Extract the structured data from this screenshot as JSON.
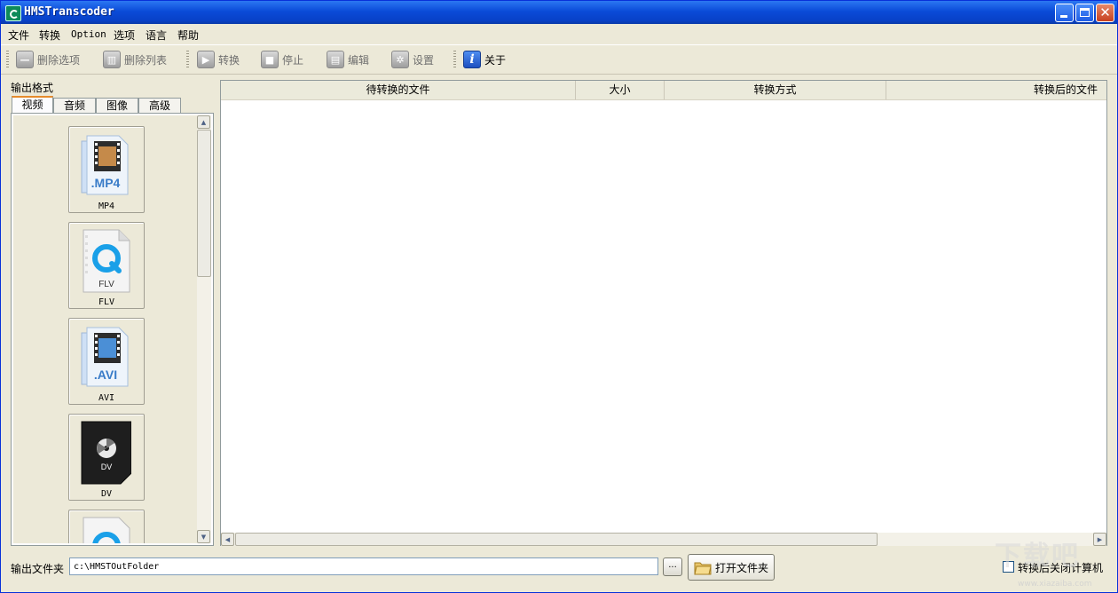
{
  "window": {
    "title": "HMSTranscoder"
  },
  "menu": [
    "文件",
    "转换",
    "Option",
    "选项",
    "语言",
    "帮助"
  ],
  "toolbar": {
    "delete_item": "删除选项",
    "delete_list": "删除列表",
    "convert": "转换",
    "stop": "停止",
    "edit": "编辑",
    "settings": "设置",
    "about": "关于"
  },
  "left": {
    "output_format_label": "输出格式",
    "tabs": [
      "视频",
      "音频",
      "图像",
      "高级"
    ],
    "formats": [
      {
        "name": "MP4",
        "badge": ".MP4"
      },
      {
        "name": "FLV",
        "badge": "FLV"
      },
      {
        "name": "AVI",
        "badge": ".AVI"
      },
      {
        "name": "DV",
        "badge": "DV"
      },
      {
        "name": "",
        "badge": ""
      }
    ]
  },
  "table": {
    "columns": [
      "待转换的文件",
      "大小",
      "转换方式",
      "转换后的文件"
    ]
  },
  "bottom": {
    "output_folder_label": "输出文件夹",
    "output_folder_value": "c:\\HMSTOutFolder",
    "browse_label": "...",
    "open_folder_label": "打开文件夹",
    "shutdown_label": "转换后关闭计算机"
  },
  "watermark": {
    "text": "下载吧",
    "url": "www.xiazaiba.com"
  },
  "colors": {
    "titlebar": "#0a4bd8",
    "tab_highlight": "#e68b2c",
    "face": "#ece9d8"
  }
}
